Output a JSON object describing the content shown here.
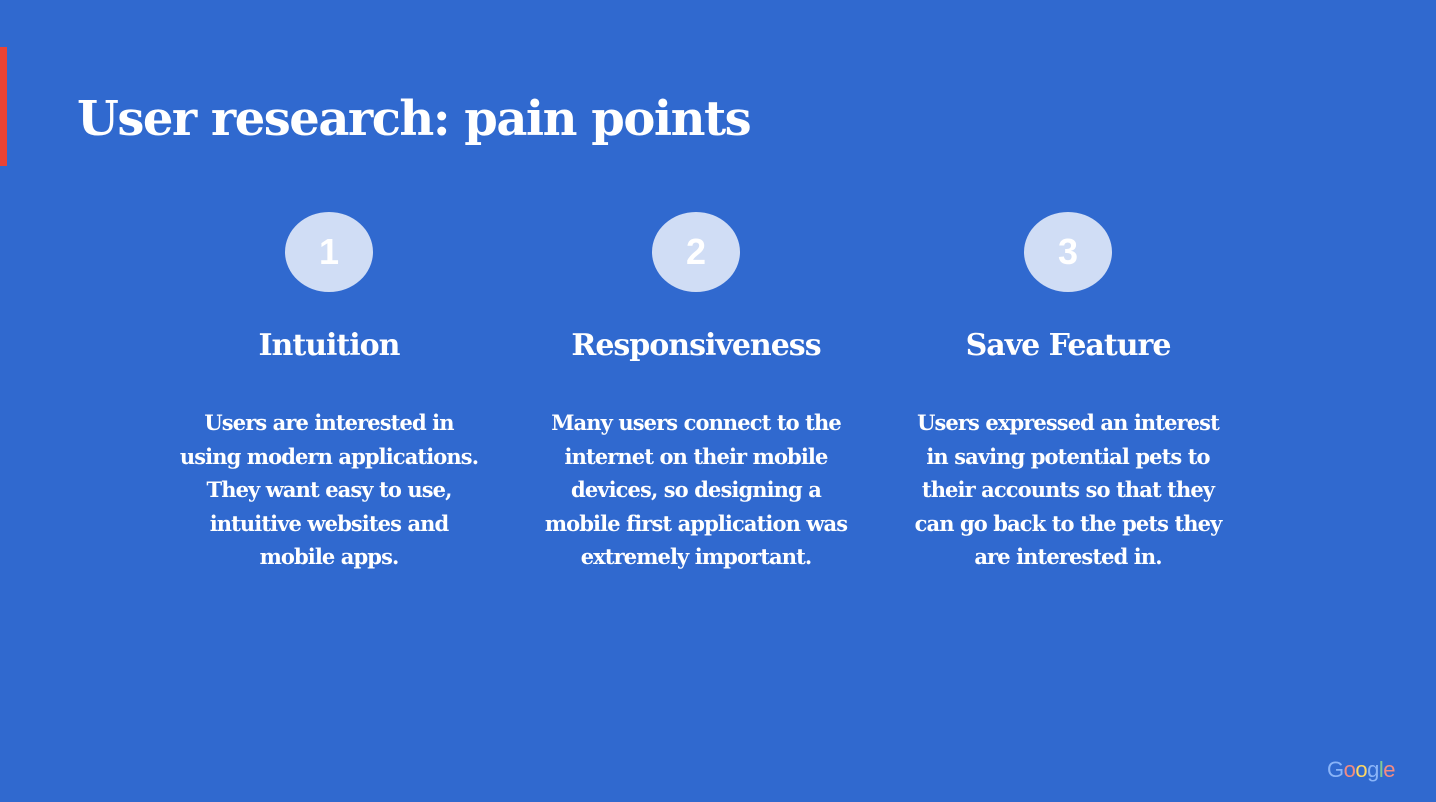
{
  "slide": {
    "title": "User research: pain points",
    "colors": {
      "background": "#3069cf",
      "accent_bar": "#ea4335",
      "circle_fill": "#d0ddf5",
      "text": "#ffffff"
    },
    "pain_points": [
      {
        "number": "1",
        "heading": "Intuition",
        "body": "Users are interested in using modern applications. They want easy to use, intuitive websites and mobile apps."
      },
      {
        "number": "2",
        "heading": "Responsiveness",
        "body": "Many users connect to the internet on their mobile devices, so designing a mobile first application was extremely important."
      },
      {
        "number": "3",
        "heading": "Save Feature",
        "body": "Users expressed an interest in saving potential pets to their accounts so that they can go back to the pets they are interested in."
      }
    ],
    "logo": {
      "letters": [
        "G",
        "o",
        "o",
        "g",
        "l",
        "e"
      ]
    }
  }
}
